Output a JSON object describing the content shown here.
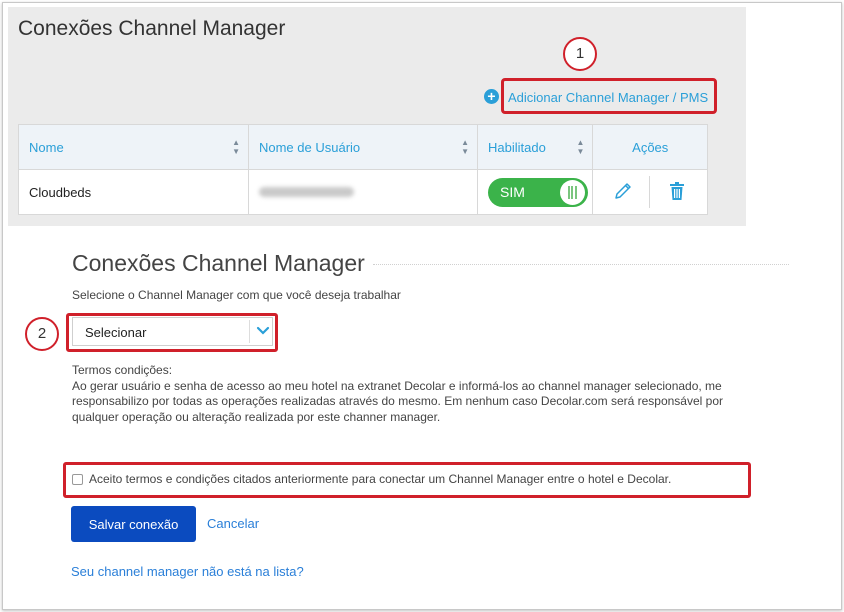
{
  "top_panel": {
    "title": "Conexões Channel Manager",
    "callout_1": "1",
    "add_link_label": "Adicionar Channel Manager / PMS",
    "table": {
      "headers": [
        "Nome",
        "Nome de Usuário",
        "Habilitado",
        "Ações"
      ],
      "rows": [
        {
          "name": "Cloudbeds",
          "toggle_label": "SIM"
        }
      ]
    }
  },
  "form": {
    "title": "Conexões Channel Manager",
    "subtitle": "Selecione o Channel Manager com que você deseja trabalhar",
    "callout_2": "2",
    "select_value": "Selecionar",
    "terms_title": "Termos condições:",
    "terms_body": "Ao gerar usuário e senha de acesso ao meu hotel na extranet Decolar e informá-los ao channel manager selecionado, me responsabilizo por todas as operações realizadas através do mesmo. Em nenhum caso Decolar.com será responsável por qualquer operação ou alteração realizada por este channer manager.",
    "accept_label": "Aceito termos e condições citados anteriormente para conectar um Channel Manager entre o hotel e Decolar.",
    "save_label": "Salvar conexão",
    "cancel_label": "Cancelar",
    "missing_link": "Seu channel manager não está na lista?"
  },
  "colors": {
    "accent_blue": "#2a9fd8",
    "highlight_red": "#d0202a",
    "toggle_green": "#3bb34a",
    "primary_button": "#0b4bbf"
  },
  "icons": [
    "plus-circle-icon",
    "sort-icon",
    "pencil-icon",
    "trash-icon",
    "chevron-down-icon",
    "toggle-grip-icon"
  ]
}
